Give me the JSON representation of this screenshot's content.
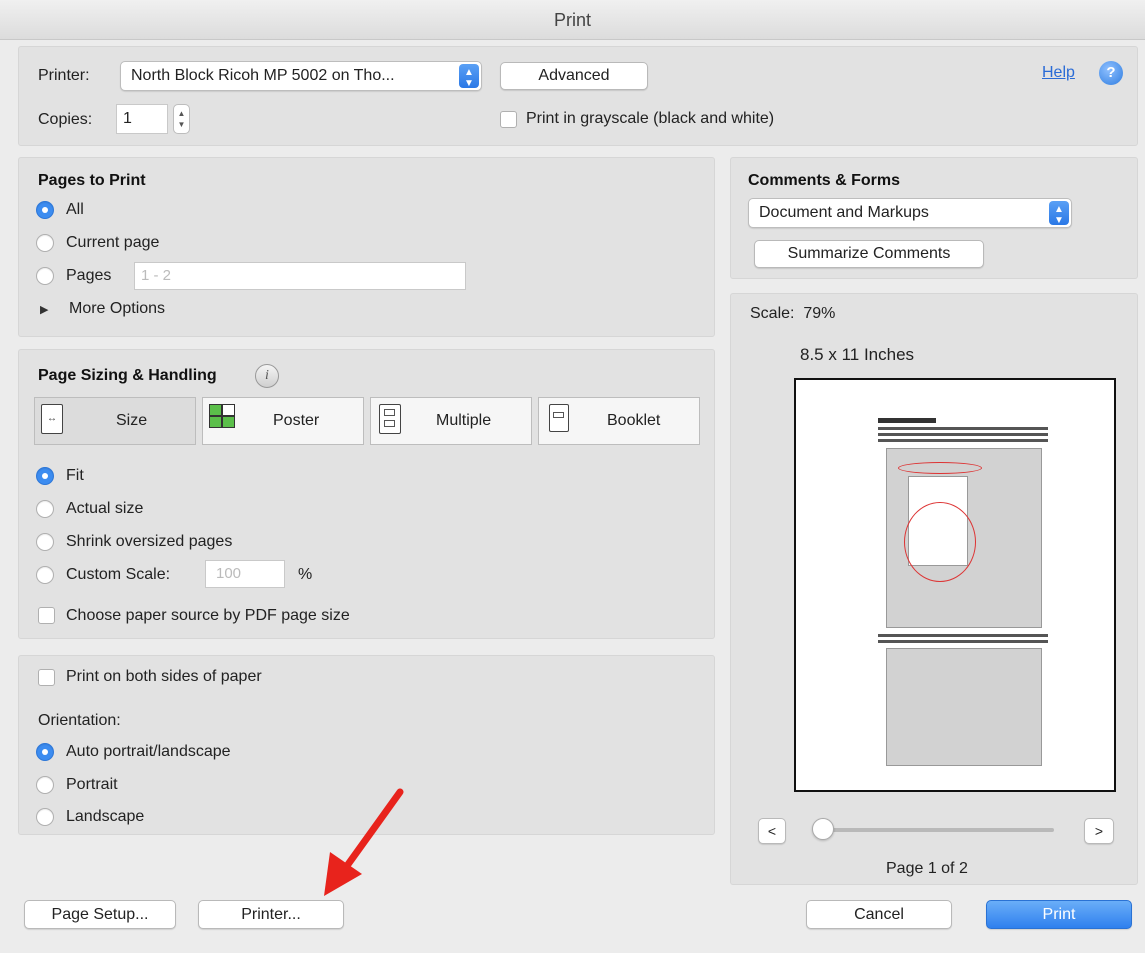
{
  "window": {
    "title": "Print"
  },
  "header": {
    "printer_label": "Printer:",
    "printer_value": "North Block Ricoh MP 5002 on Tho...",
    "advanced_label": "Advanced",
    "help_label": "Help",
    "help_icon": "?",
    "copies_label": "Copies:",
    "copies_value": "1",
    "grayscale_label": "Print in grayscale (black and white)"
  },
  "pages_to_print": {
    "heading": "Pages to Print",
    "all_label": "All",
    "current_label": "Current page",
    "pages_label": "Pages",
    "pages_placeholder": "1 - 2",
    "more_options_label": "More Options",
    "selected": "All"
  },
  "sizing": {
    "heading": "Page Sizing & Handling",
    "info_icon": "i",
    "tabs": [
      "Size",
      "Poster",
      "Multiple",
      "Booklet"
    ],
    "selected_tab": "Size",
    "fit_label": "Fit",
    "actual_label": "Actual size",
    "shrink_label": "Shrink oversized pages",
    "custom_label": "Custom Scale:",
    "custom_value": "100",
    "percent_label": "%",
    "paper_source_label": "Choose paper source by PDF page size",
    "selected": "Fit"
  },
  "duplex": {
    "both_sides_label": "Print on both sides of paper",
    "orientation_label": "Orientation:",
    "auto_label": "Auto portrait/landscape",
    "portrait_label": "Portrait",
    "landscape_label": "Landscape",
    "selected": "Auto portrait/landscape"
  },
  "comments": {
    "heading": "Comments & Forms",
    "select_value": "Document and Markups",
    "summarize_label": "Summarize Comments"
  },
  "preview": {
    "scale_label": "Scale:  79%",
    "size_label": "8.5 x 11 Inches",
    "prev_label": "<",
    "next_label": ">",
    "page_label": "Page 1 of 2",
    "slider_value": 0
  },
  "footer": {
    "page_setup_label": "Page Setup...",
    "printer_label": "Printer...",
    "cancel_label": "Cancel",
    "print_label": "Print"
  },
  "colors": {
    "accent": "#3c8cf0",
    "arrow": "#e8231c",
    "help": "#2a6bd6"
  },
  "icons": [
    "chevron-updown-icon",
    "help-icon",
    "info-icon",
    "size-icon",
    "poster-icon",
    "multiple-icon",
    "booklet-icon",
    "disclosure-triangle-icon",
    "red-arrow-icon"
  ]
}
